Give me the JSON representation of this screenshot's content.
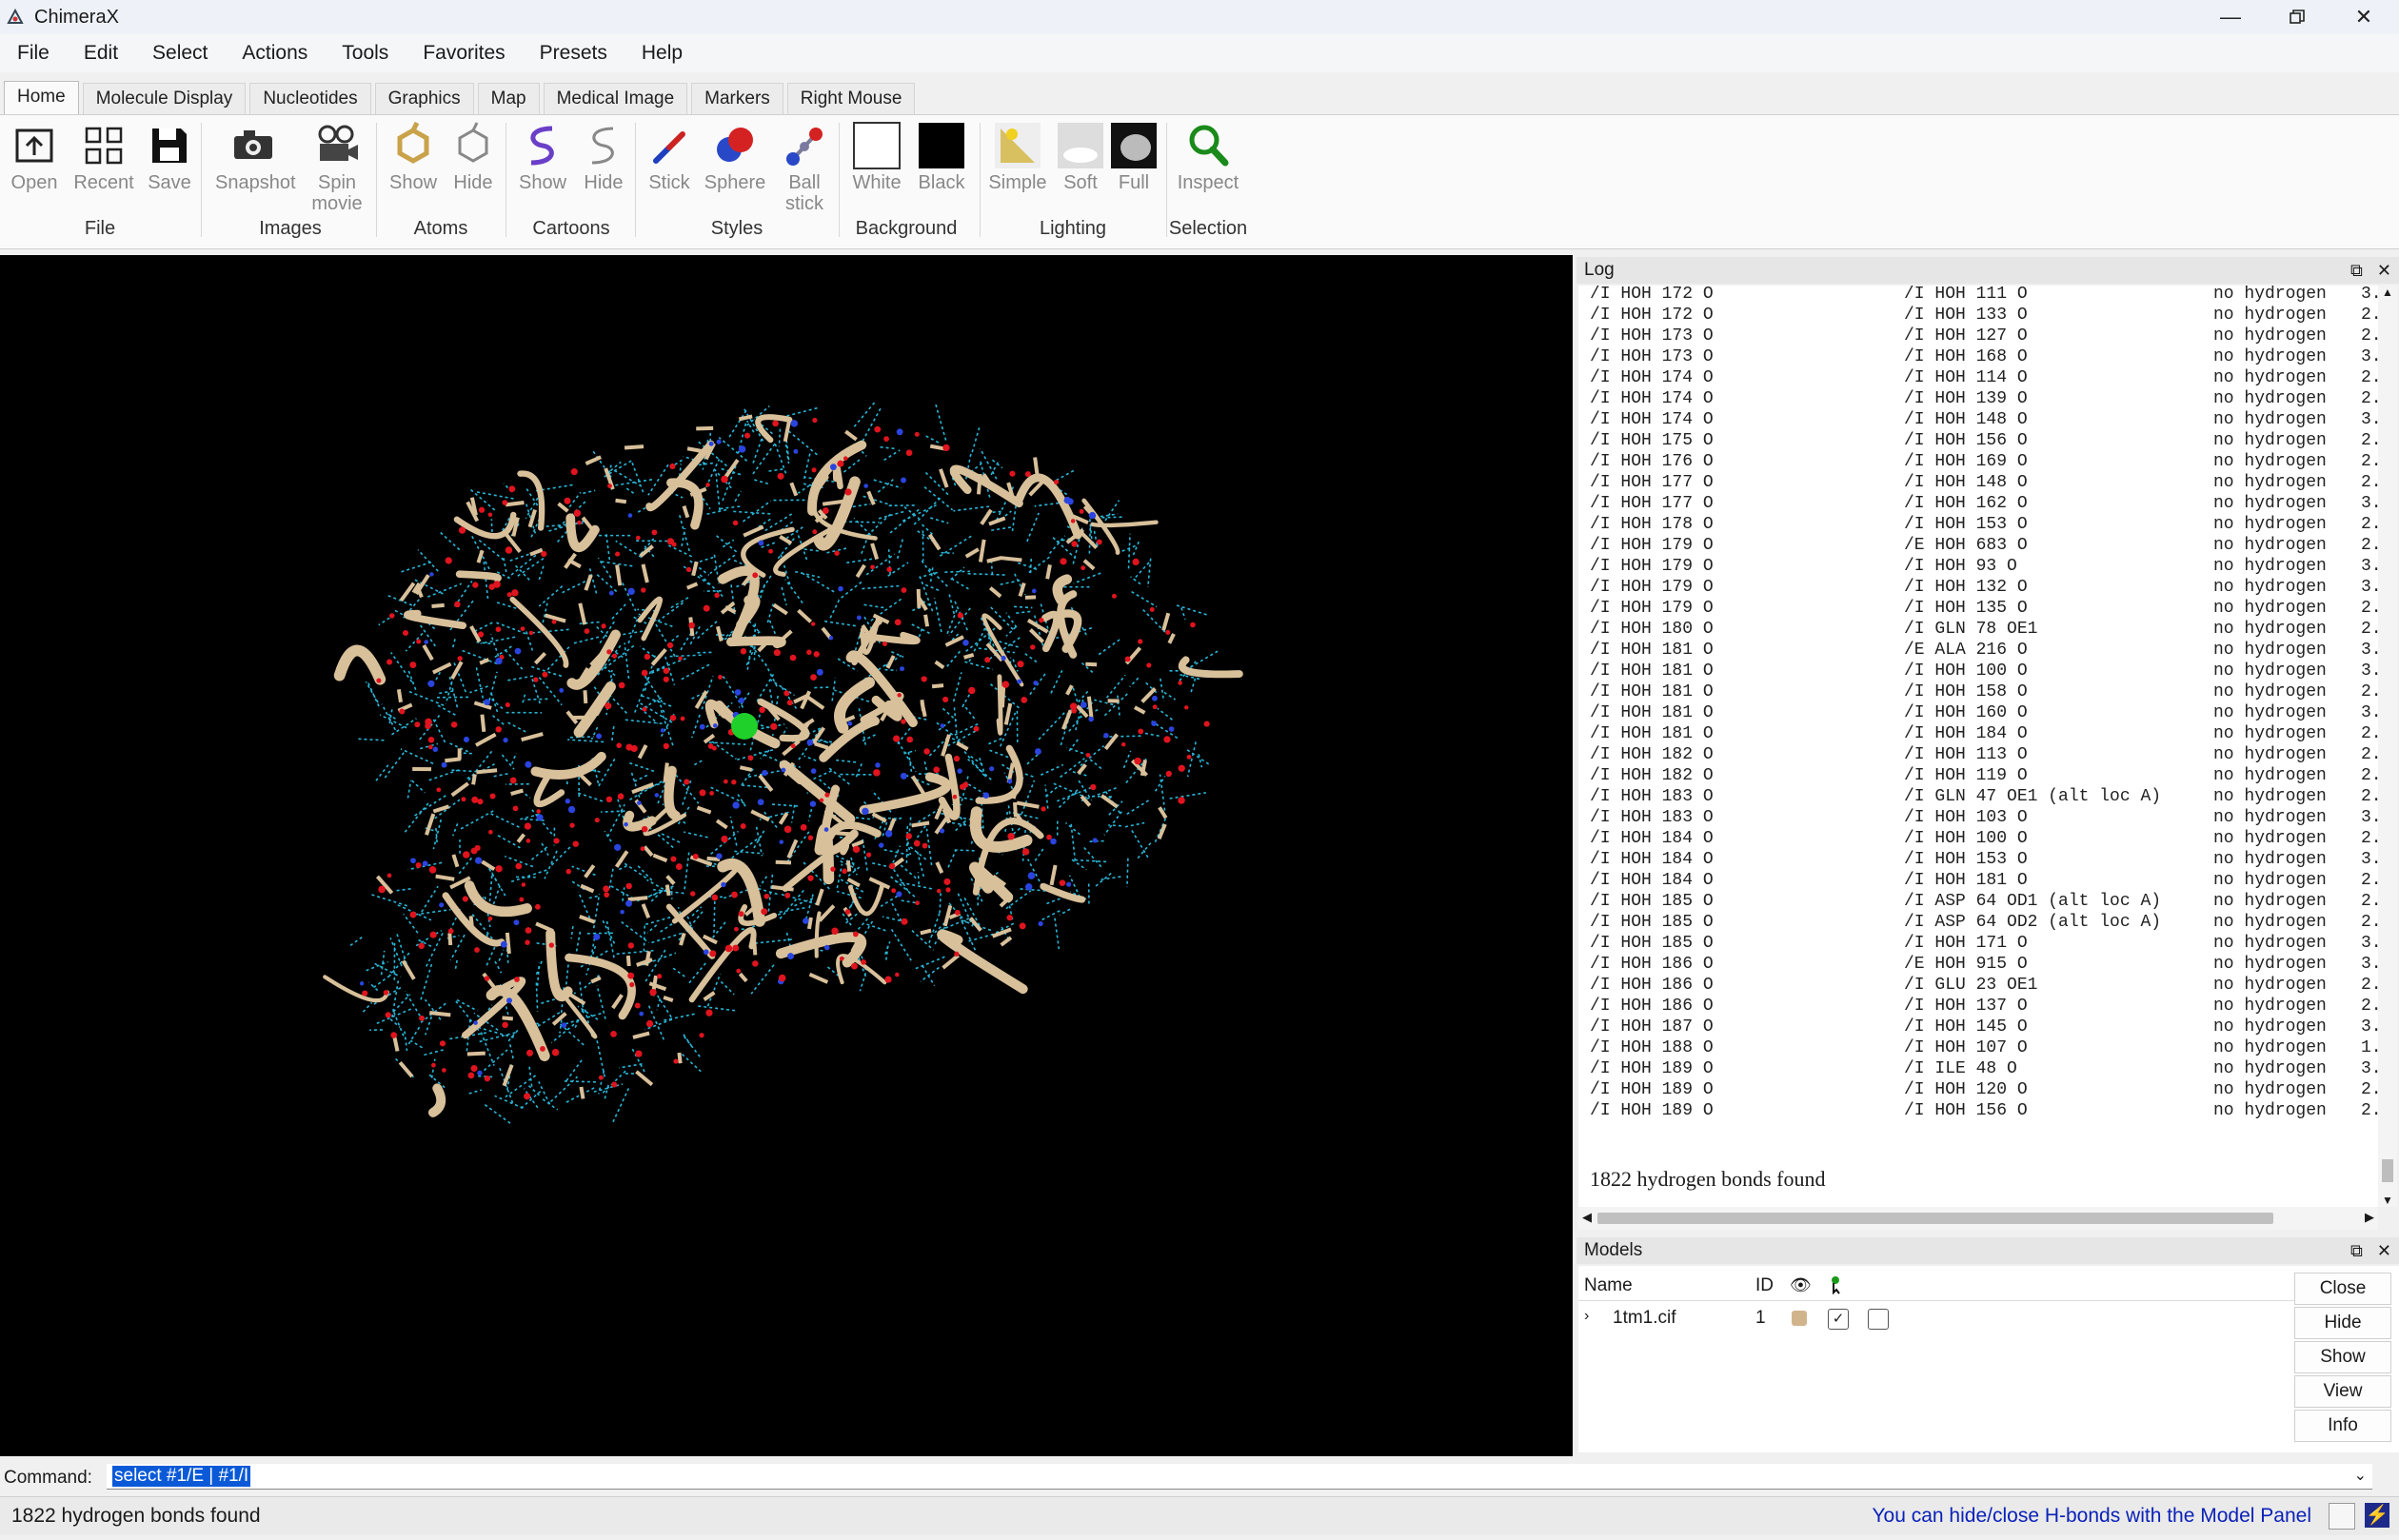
{
  "window": {
    "title": "ChimeraX",
    "app_icon": "chimerax-icon"
  },
  "menubar": [
    "File",
    "Edit",
    "Select",
    "Actions",
    "Tools",
    "Favorites",
    "Presets",
    "Help"
  ],
  "tabs": [
    "Home",
    "Molecule Display",
    "Nucleotides",
    "Graphics",
    "Map",
    "Medical Image",
    "Markers",
    "Right Mouse"
  ],
  "active_tab": "Home",
  "ribbon": {
    "buttons": [
      {
        "label": "Open",
        "icon": "open-icon"
      },
      {
        "label": "Recent",
        "icon": "recent-grid-icon"
      },
      {
        "label": "Save",
        "icon": "save-disk-icon"
      },
      {
        "label": "Snapshot",
        "icon": "camera-icon"
      },
      {
        "label": "Spin\nmovie",
        "icon": "movie-camera-icon"
      },
      {
        "label": "Show",
        "icon": "atoms-show-icon"
      },
      {
        "label": "Hide",
        "icon": "atoms-hide-icon"
      },
      {
        "label": "Show",
        "icon": "cartoon-show-icon"
      },
      {
        "label": "Hide",
        "icon": "cartoon-hide-icon"
      },
      {
        "label": "Stick",
        "icon": "stick-style-icon"
      },
      {
        "label": "Sphere",
        "icon": "sphere-style-icon"
      },
      {
        "label": "Ball\nstick",
        "icon": "ball-stick-style-icon"
      },
      {
        "label": "White",
        "icon": "white-background-icon"
      },
      {
        "label": "Black",
        "icon": "black-background-icon"
      },
      {
        "label": "Simple",
        "icon": "simple-lighting-icon"
      },
      {
        "label": "Soft",
        "icon": "soft-lighting-icon"
      },
      {
        "label": "Full",
        "icon": "full-lighting-icon"
      },
      {
        "label": "Inspect",
        "icon": "magnifier-icon"
      }
    ],
    "groups": [
      "File",
      "Images",
      "Atoms",
      "Cartoons",
      "Styles",
      "Background",
      "Lighting",
      "Selection"
    ]
  },
  "log": {
    "title": "Log",
    "rows": [
      [
        "/I HOH 172 O",
        "/I HOH 111 O",
        "no hydrogen",
        "3."
      ],
      [
        "/I HOH 172 O",
        "/I HOH 133 O",
        "no hydrogen",
        "2."
      ],
      [
        "/I HOH 173 O",
        "/I HOH 127 O",
        "no hydrogen",
        "2."
      ],
      [
        "/I HOH 173 O",
        "/I HOH 168 O",
        "no hydrogen",
        "3."
      ],
      [
        "/I HOH 174 O",
        "/I HOH 114 O",
        "no hydrogen",
        "2."
      ],
      [
        "/I HOH 174 O",
        "/I HOH 139 O",
        "no hydrogen",
        "2."
      ],
      [
        "/I HOH 174 O",
        "/I HOH 148 O",
        "no hydrogen",
        "3."
      ],
      [
        "/I HOH 175 O",
        "/I HOH 156 O",
        "no hydrogen",
        "2."
      ],
      [
        "/I HOH 176 O",
        "/I HOH 169 O",
        "no hydrogen",
        "2."
      ],
      [
        "/I HOH 177 O",
        "/I HOH 148 O",
        "no hydrogen",
        "2."
      ],
      [
        "/I HOH 177 O",
        "/I HOH 162 O",
        "no hydrogen",
        "3."
      ],
      [
        "/I HOH 178 O",
        "/I HOH 153 O",
        "no hydrogen",
        "2."
      ],
      [
        "/I HOH 179 O",
        "/E HOH 683 O",
        "no hydrogen",
        "2."
      ],
      [
        "/I HOH 179 O",
        "/I HOH 93 O",
        "no hydrogen",
        "3."
      ],
      [
        "/I HOH 179 O",
        "/I HOH 132 O",
        "no hydrogen",
        "3."
      ],
      [
        "/I HOH 179 O",
        "/I HOH 135 O",
        "no hydrogen",
        "2."
      ],
      [
        "/I HOH 180 O",
        "/I GLN 78 OE1",
        "no hydrogen",
        "2."
      ],
      [
        "/I HOH 181 O",
        "/E ALA 216 O",
        "no hydrogen",
        "3."
      ],
      [
        "/I HOH 181 O",
        "/I HOH 100 O",
        "no hydrogen",
        "3."
      ],
      [
        "/I HOH 181 O",
        "/I HOH 158 O",
        "no hydrogen",
        "2."
      ],
      [
        "/I HOH 181 O",
        "/I HOH 160 O",
        "no hydrogen",
        "3."
      ],
      [
        "/I HOH 181 O",
        "/I HOH 184 O",
        "no hydrogen",
        "2."
      ],
      [
        "/I HOH 182 O",
        "/I HOH 113 O",
        "no hydrogen",
        "2."
      ],
      [
        "/I HOH 182 O",
        "/I HOH 119 O",
        "no hydrogen",
        "2."
      ],
      [
        "/I HOH 183 O",
        "/I GLN 47 OE1 (alt loc A)",
        "no hydrogen",
        "2."
      ],
      [
        "/I HOH 183 O",
        "/I HOH 103 O",
        "no hydrogen",
        "3."
      ],
      [
        "/I HOH 184 O",
        "/I HOH 100 O",
        "no hydrogen",
        "2."
      ],
      [
        "/I HOH 184 O",
        "/I HOH 153 O",
        "no hydrogen",
        "3."
      ],
      [
        "/I HOH 184 O",
        "/I HOH 181 O",
        "no hydrogen",
        "2."
      ],
      [
        "/I HOH 185 O",
        "/I ASP 64 OD1 (alt loc A)",
        "no hydrogen",
        "2."
      ],
      [
        "/I HOH 185 O",
        "/I ASP 64 OD2 (alt loc A)",
        "no hydrogen",
        "2."
      ],
      [
        "/I HOH 185 O",
        "/I HOH 171 O",
        "no hydrogen",
        "3."
      ],
      [
        "/I HOH 186 O",
        "/E HOH 915 O",
        "no hydrogen",
        "3."
      ],
      [
        "/I HOH 186 O",
        "/I GLU 23 OE1",
        "no hydrogen",
        "2."
      ],
      [
        "/I HOH 186 O",
        "/I HOH 137 O",
        "no hydrogen",
        "2."
      ],
      [
        "/I HOH 187 O",
        "/I HOH 145 O",
        "no hydrogen",
        "3."
      ],
      [
        "/I HOH 188 O",
        "/I HOH 107 O",
        "no hydrogen",
        "1."
      ],
      [
        "/I HOH 189 O",
        "/I ILE 48 O",
        "no hydrogen",
        "3."
      ],
      [
        "/I HOH 189 O",
        "/I HOH 120 O",
        "no hydrogen",
        "2."
      ],
      [
        "/I HOH 189 O",
        "/I HOH 156 O",
        "no hydrogen",
        "2."
      ]
    ],
    "summary": "1822 hydrogen bonds found"
  },
  "models": {
    "title": "Models",
    "columns": [
      "Name",
      "ID"
    ],
    "rows": [
      {
        "name": "1tm1.cif",
        "id": "1",
        "color": "#d2b48c",
        "shown": true,
        "selected": false
      }
    ],
    "buttons": [
      "Close",
      "Hide",
      "Show",
      "View",
      "Info"
    ]
  },
  "command": {
    "label": "Command:",
    "value": "select #1/E | #1/I"
  },
  "status": {
    "left": "1822 hydrogen bonds found",
    "right": "You can hide/close H-bonds with the Model Panel"
  },
  "colors": {
    "accent": "#0b22b8",
    "selection": "#0a5ad8",
    "viewer_bg": "#000000",
    "ribbon_tan": "#d8c09a",
    "hbond": "#29b6d8"
  }
}
